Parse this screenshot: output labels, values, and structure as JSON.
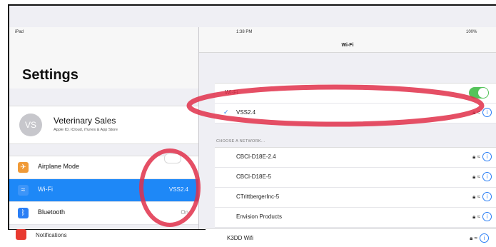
{
  "status_bar": {
    "carrier": "iPad",
    "time": "1:38 PM",
    "battery": "100%"
  },
  "left": {
    "title": "Settings",
    "profile": {
      "initials": "VS",
      "name": "Veterinary Sales",
      "subtitle": "Apple ID, iCloud, iTunes & App Store"
    },
    "items": [
      {
        "label": "Airplane Mode",
        "value": "",
        "icon": "airplane-icon",
        "color": "#f09a37"
      },
      {
        "label": "Wi-Fi",
        "value": "VSS2.4",
        "icon": "wifi-icon",
        "color": "#2a7ef5"
      },
      {
        "label": "Bluetooth",
        "value": "On",
        "icon": "bluetooth-icon",
        "color": "#2a7ef5"
      }
    ],
    "next_item": "Notifications"
  },
  "right": {
    "nav_title": "Wi-Fi",
    "wifi_label": "Wi-Fi",
    "connected": "VSS2.4",
    "choose_header": "CHOOSE A NETWORK...",
    "networks": [
      "CBCI-D18E-2.4",
      "CBCI-D18E-5",
      "CTrittbergerInc-5",
      "Envision Products",
      "K3DD Wifi"
    ]
  },
  "colors": {
    "selected_row": "#1e88f7",
    "toggle_on": "#55c35a",
    "annotation": "#e0304a"
  }
}
